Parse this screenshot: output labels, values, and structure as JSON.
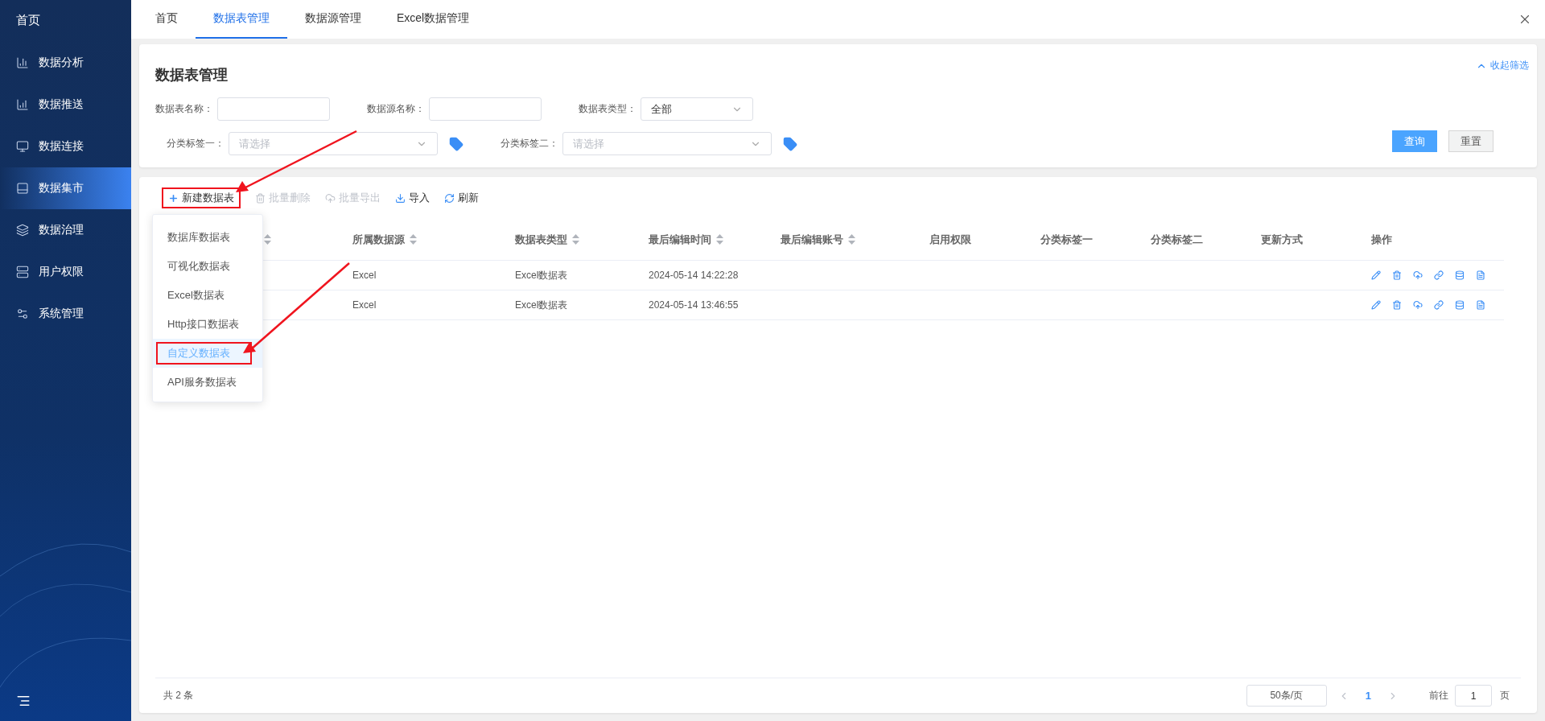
{
  "sidebar": {
    "home": "首页",
    "items": [
      {
        "label": "数据分析",
        "selected": false
      },
      {
        "label": "数据推送",
        "selected": false
      },
      {
        "label": "数据连接",
        "selected": false
      },
      {
        "label": "数据集市",
        "selected": true
      },
      {
        "label": "数据治理",
        "selected": false
      },
      {
        "label": "用户权限",
        "selected": false
      },
      {
        "label": "系统管理",
        "selected": false
      }
    ]
  },
  "tabs": [
    {
      "label": "首页",
      "selected": false
    },
    {
      "label": "数据表管理",
      "selected": true
    },
    {
      "label": "数据源管理",
      "selected": false
    },
    {
      "label": "Excel数据管理",
      "selected": false
    }
  ],
  "filter": {
    "title": "数据表管理",
    "collapse_link": "收起筛选",
    "rows": [
      [
        {
          "kind": "input",
          "label": "数据表名称："
        },
        {
          "kind": "input",
          "label": "数据源名称："
        },
        {
          "kind": "select",
          "label": "数据表类型：",
          "value": "全部"
        }
      ],
      [
        {
          "kind": "tag-select",
          "label": "分类标签一：",
          "placeholder": "请选择"
        },
        {
          "kind": "tag-select",
          "label": "分类标签二：",
          "placeholder": "请选择"
        }
      ]
    ],
    "buttons": [
      {
        "label": "查询",
        "primary": true
      },
      {
        "label": "重置",
        "primary": false
      }
    ]
  },
  "toolbar": [
    {
      "kind": "add",
      "label": "新建数据表",
      "disabled": false,
      "highlighted": true
    },
    {
      "kind": "delete",
      "label": "批量删除",
      "disabled": true,
      "highlighted": false
    },
    {
      "kind": "export",
      "label": "批量导出",
      "disabled": true,
      "highlighted": false
    },
    {
      "kind": "import",
      "label": "导入",
      "disabled": false,
      "highlighted": false
    },
    {
      "kind": "refresh",
      "label": "刷新",
      "disabled": false,
      "highlighted": false
    }
  ],
  "menu": {
    "items": [
      {
        "label": "数据库数据表",
        "selected": false,
        "highlighted": false
      },
      {
        "label": "可视化数据表",
        "selected": false,
        "highlighted": false
      },
      {
        "label": "Excel数据表",
        "selected": false,
        "highlighted": false
      },
      {
        "label": "Http接口数据表",
        "selected": false,
        "highlighted": false
      },
      {
        "label": "自定义数据表",
        "selected": true,
        "highlighted": true
      },
      {
        "label": "API服务数据表",
        "selected": false,
        "highlighted": false
      }
    ]
  },
  "table": {
    "columns": [
      {
        "sortable": true
      },
      {
        "label": "所属数据源",
        "sortable": true
      },
      {
        "label": "数据表类型",
        "sortable": true
      },
      {
        "label": "最后编辑时间",
        "sortable": true
      },
      {
        "label": "最后编辑账号",
        "sortable": true
      },
      {
        "label": "启用权限",
        "sortable": false
      },
      {
        "label": "分类标签一",
        "sortable": false
      },
      {
        "label": "分类标签二",
        "sortable": false
      },
      {
        "label": "更新方式",
        "sortable": false
      },
      {
        "label": "操作",
        "sortable": false
      }
    ],
    "rows": [
      {
        "cells": [
          "",
          "Excel",
          "Excel数据表",
          "2024-05-14 14:22:28"
        ]
      },
      {
        "cells": [
          "",
          "Excel",
          "Excel数据表",
          "2024-05-14 13:46:55"
        ]
      }
    ]
  },
  "pagination": {
    "total": "共 2 条",
    "page_size": "50条/页",
    "pages": [
      {
        "label": "1",
        "selected": true
      }
    ],
    "goto_label": "前往",
    "goto_value": "1",
    "goto_suffix": "页"
  }
}
